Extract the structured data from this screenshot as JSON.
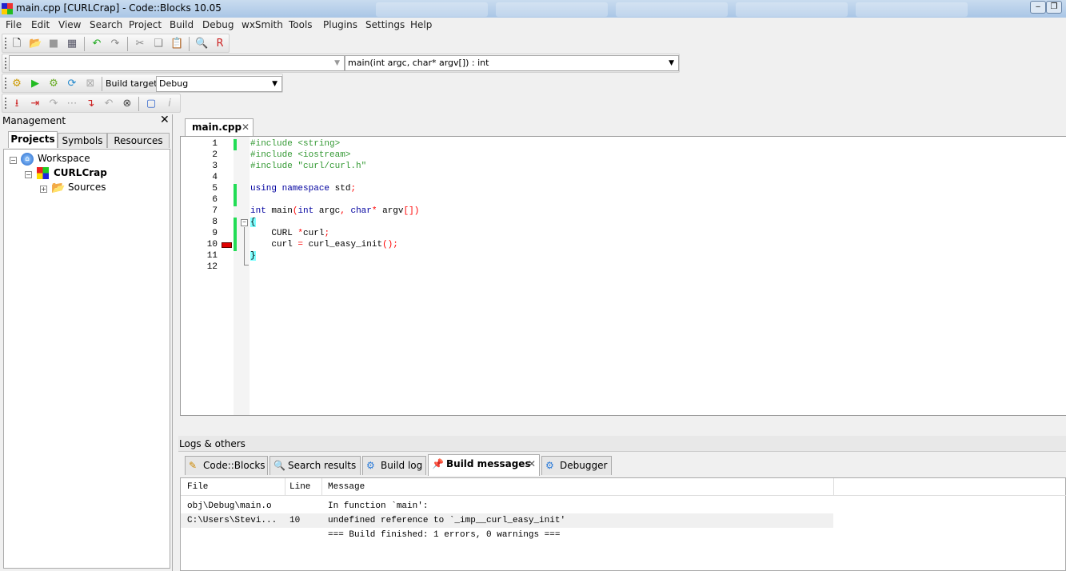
{
  "window": {
    "title": "main.cpp [CURLCrap] - Code::Blocks 10.05"
  },
  "menu": [
    "File",
    "Edit",
    "View",
    "Search",
    "Project",
    "Build",
    "Debug",
    "wxSmith",
    "Tools",
    "Plugins",
    "Settings",
    "Help"
  ],
  "toolbar": {
    "build_target_label": "Build target:",
    "build_target_value": "Debug",
    "scope_value": "",
    "function_value": "main(int argc, char* argv[]) : int"
  },
  "management": {
    "title": "Management",
    "tabs": [
      "Projects",
      "Symbols",
      "Resources"
    ],
    "active_tab": "Projects",
    "tree": {
      "workspace": "Workspace",
      "project": "CURLCrap",
      "folder": "Sources"
    }
  },
  "editor": {
    "tab": "main.cpp",
    "error_line": 10,
    "lines": [
      [
        [
          "#include <string>",
          "pp"
        ]
      ],
      [
        [
          "#include <iostream>",
          "pp"
        ]
      ],
      [
        [
          "#include \"curl/curl.h\"",
          "pp"
        ]
      ],
      [],
      [
        [
          "using namespace",
          "kw"
        ],
        [
          " std",
          "id"
        ],
        [
          ";",
          "op"
        ]
      ],
      [],
      [
        [
          "int",
          "kw"
        ],
        [
          " main",
          "id"
        ],
        [
          "(",
          "op"
        ],
        [
          "int",
          "kw"
        ],
        [
          " argc",
          "id"
        ],
        [
          ",",
          "op"
        ],
        [
          " char",
          "kw"
        ],
        [
          "*",
          "op"
        ],
        [
          " argv",
          "id"
        ],
        [
          "[])",
          "op"
        ]
      ],
      [
        [
          "{",
          "br"
        ]
      ],
      [
        [
          "    CURL ",
          "id"
        ],
        [
          "*",
          "op"
        ],
        [
          "curl",
          "id"
        ],
        [
          ";",
          "op"
        ]
      ],
      [
        [
          "    curl ",
          "id"
        ],
        [
          "=",
          "op"
        ],
        [
          " curl_easy_init",
          "id"
        ],
        [
          "();",
          "op"
        ]
      ],
      [
        [
          "}",
          "br"
        ]
      ],
      []
    ]
  },
  "logs": {
    "title": "Logs & others",
    "tabs": [
      "Code::Blocks",
      "Search results",
      "Build log",
      "Build messages",
      "Debugger"
    ],
    "active_tab": "Build messages",
    "columns": [
      "File",
      "Line",
      "Message"
    ],
    "rows": [
      {
        "file": "obj\\Debug\\main.o",
        "line": "",
        "message": "In function `main':"
      },
      {
        "file": "C:\\Users\\Stevi...",
        "line": "10",
        "message": "undefined reference to `_imp__curl_easy_init'"
      },
      {
        "file": "",
        "line": "",
        "message": "=== Build finished: 1 errors, 0 warnings ==="
      }
    ]
  },
  "colors": {
    "error_marker": "#e00000",
    "changed_bar": "#22dd55"
  }
}
